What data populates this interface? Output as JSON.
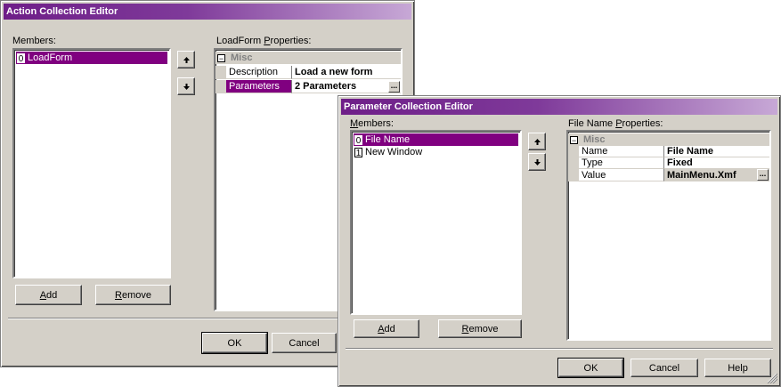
{
  "action_editor": {
    "title": "Action Collection Editor",
    "members_label": "Members:",
    "members": [
      {
        "index": "0",
        "label": "LoadForm",
        "selected": true
      }
    ],
    "move_up_icon": "arrow-up-icon",
    "move_down_icon": "arrow-down-icon",
    "properties_label_prefix": "LoadForm ",
    "properties_label_accel": "P",
    "properties_label_rest": "roperties:",
    "category": {
      "toggle": "⊟",
      "name": "Misc"
    },
    "properties": [
      {
        "name": "Description",
        "value": "Load a new form"
      },
      {
        "name": "Parameters",
        "value": "2 Parameters",
        "selected": true,
        "has_ellipsis": true
      }
    ],
    "ellipsis_label": "...",
    "add_accel": "A",
    "add_rest": "dd",
    "remove_accel": "R",
    "remove_rest": "emove",
    "ok_label": "OK",
    "cancel_label": "Cancel"
  },
  "parameter_editor": {
    "title": "Parameter Collection Editor",
    "members_label_accel": "M",
    "members_label_rest": "embers:",
    "members": [
      {
        "index": "0",
        "label": "File Name",
        "selected": true
      },
      {
        "index": "1",
        "label": "New Window",
        "selected": false
      }
    ],
    "properties_label_prefix": "File Name ",
    "properties_label_accel": "P",
    "properties_label_rest": "roperties:",
    "category": {
      "toggle": "⊟",
      "name": "Misc"
    },
    "properties": [
      {
        "name": "Name",
        "value": "File Name"
      },
      {
        "name": "Type",
        "value": "Fixed"
      },
      {
        "name": "Value",
        "value": "MainMenu.Xmf",
        "has_ellipsis": true,
        "grey_value": true
      }
    ],
    "ellipsis_label": "...",
    "add_accel": "A",
    "add_rest": "dd",
    "remove_accel": "R",
    "remove_rest": "emove",
    "ok_label": "OK",
    "cancel_label": "Cancel",
    "help_label": "Help",
    "resize_icon": "resize-grip-icon"
  },
  "colors": {
    "dialog_face": "#d4d0c8",
    "selection": "#800080",
    "title_start": "#6e1e88",
    "title_end": "#c7a8d6"
  }
}
